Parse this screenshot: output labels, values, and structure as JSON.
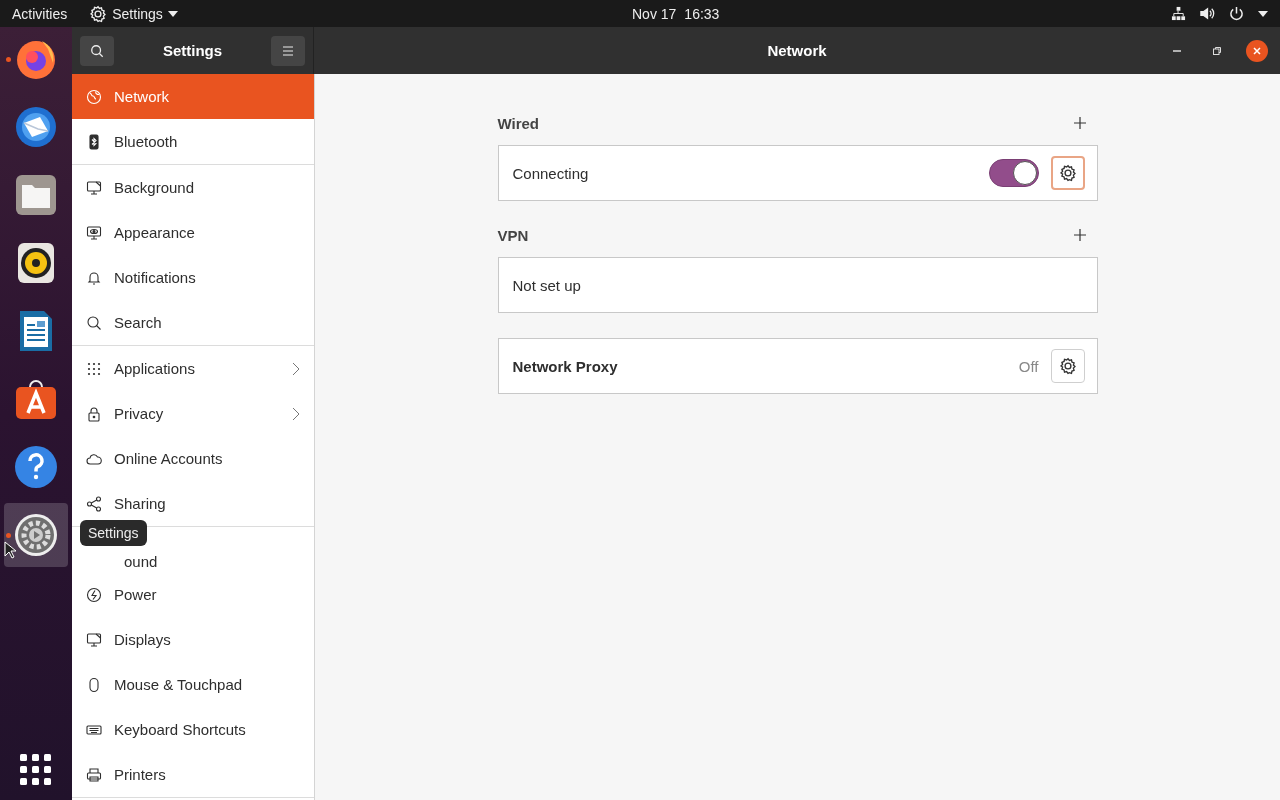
{
  "top_bar": {
    "activities": "Activities",
    "app_menu": "Settings",
    "date": "Nov 17",
    "time": "16:33"
  },
  "dock": {
    "items": [
      {
        "kind": "firefox",
        "running": true,
        "selected": false
      },
      {
        "kind": "thunderbird",
        "running": false,
        "selected": false
      },
      {
        "kind": "files",
        "running": false,
        "selected": false
      },
      {
        "kind": "rhythmbox",
        "running": false,
        "selected": false
      },
      {
        "kind": "writer",
        "running": false,
        "selected": false
      },
      {
        "kind": "software",
        "running": false,
        "selected": false
      },
      {
        "kind": "help",
        "running": false,
        "selected": false
      },
      {
        "kind": "settings",
        "running": true,
        "selected": true
      }
    ],
    "tooltip": "Settings"
  },
  "window": {
    "sidebar_title": "Settings",
    "title": "Network"
  },
  "sidebar": {
    "groups": [
      {
        "items": [
          {
            "label": "Network",
            "selected": true,
            "submenu": false
          },
          {
            "label": "Bluetooth",
            "selected": false,
            "submenu": false
          }
        ]
      },
      {
        "items": [
          {
            "label": "Background",
            "selected": false,
            "submenu": false
          },
          {
            "label": "Appearance",
            "selected": false,
            "submenu": false
          },
          {
            "label": "Notifications",
            "selected": false,
            "submenu": false
          },
          {
            "label": "Search",
            "selected": false,
            "submenu": false
          }
        ]
      },
      {
        "items": [
          {
            "label": "Applications",
            "selected": false,
            "submenu": true
          },
          {
            "label": "Privacy",
            "selected": false,
            "submenu": true
          },
          {
            "label": "Online Accounts",
            "selected": false,
            "submenu": false
          },
          {
            "label": "Sharing",
            "selected": false,
            "submenu": false
          }
        ]
      },
      {
        "items": [
          {
            "label": "ound",
            "selected": false,
            "submenu": false
          },
          {
            "label": "Power",
            "selected": false,
            "submenu": false
          },
          {
            "label": "Displays",
            "selected": false,
            "submenu": false
          },
          {
            "label": "Mouse & Touchpad",
            "selected": false,
            "submenu": false
          },
          {
            "label": "Keyboard Shortcuts",
            "selected": false,
            "submenu": false
          },
          {
            "label": "Printers",
            "selected": false,
            "submenu": false
          }
        ]
      }
    ]
  },
  "main": {
    "sections": [
      {
        "title": "Wired",
        "rows": [
          {
            "kind": "switch",
            "label": "Connecting",
            "on": true,
            "focused": true
          }
        ]
      },
      {
        "title": "VPN",
        "rows": [
          {
            "kind": "plain",
            "label": "Not set up"
          }
        ]
      },
      {
        "rows": [
          {
            "kind": "status",
            "label": "Network Proxy",
            "status": "Off",
            "focused": false
          }
        ]
      }
    ]
  }
}
